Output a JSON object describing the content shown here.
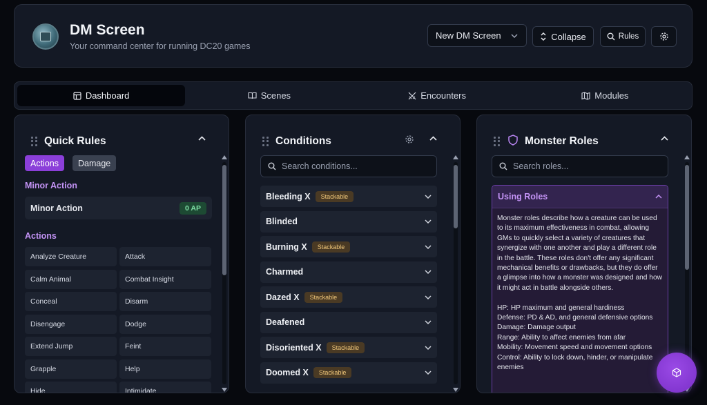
{
  "header": {
    "title": "DM Screen",
    "subtitle": "Your command center for running DC20 games",
    "screen_select": "New DM Screen",
    "collapse_label": "Collapse",
    "rules_label": "Rules"
  },
  "tabs": [
    {
      "label": "Dashboard",
      "icon": "layout-icon",
      "active": true
    },
    {
      "label": "Scenes",
      "icon": "book-open-icon",
      "active": false
    },
    {
      "label": "Encounters",
      "icon": "swords-icon",
      "active": false
    },
    {
      "label": "Modules",
      "icon": "map-icon",
      "active": false
    }
  ],
  "quick_rules": {
    "title": "Quick Rules",
    "chips": [
      "Actions",
      "Damage"
    ],
    "minor_section": "Minor Action",
    "minor_item": {
      "label": "Minor Action",
      "cost": "0 AP"
    },
    "actions_section": "Actions",
    "actions": [
      "Analyze Creature",
      "Attack",
      "Calm Animal",
      "Combat Insight",
      "Conceal",
      "Disarm",
      "Disengage",
      "Dodge",
      "Extend Jump",
      "Feint",
      "Grapple",
      "Help",
      "Hide",
      "Intimidate"
    ]
  },
  "conditions": {
    "title": "Conditions",
    "search_placeholder": "Search conditions...",
    "stack_label": "Stackable",
    "items": [
      {
        "name": "Bleeding X",
        "stackable": true
      },
      {
        "name": "Blinded",
        "stackable": false
      },
      {
        "name": "Burning X",
        "stackable": true
      },
      {
        "name": "Charmed",
        "stackable": false
      },
      {
        "name": "Dazed X",
        "stackable": true
      },
      {
        "name": "Deafened",
        "stackable": false
      },
      {
        "name": "Disoriented X",
        "stackable": true
      },
      {
        "name": "Doomed X",
        "stackable": true
      }
    ]
  },
  "monster_roles": {
    "title": "Monster Roles",
    "search_placeholder": "Search roles...",
    "section_title": "Using Roles",
    "intro": "Monster roles describe how a creature can be used to its maximum effectiveness in combat, allowing GMs to quickly select a variety of creatures that synergize with one another and play a different role in the battle. These roles don't offer any significant mechanical benefits or drawbacks, but they do offer a glimpse into how a monster was designed and how it might act in battle alongside others.",
    "lines": [
      "HP: HP maximum and general hardiness",
      "Defense: PD & AD, and general defensive options",
      "Damage: Damage output",
      "Range: Ability to affect enemies from afar",
      "Mobility: Movement speed and movement options",
      "Control: Ability to lock down, hinder, or manipulate enemies"
    ]
  },
  "colors": {
    "accent": "#8b3fd9",
    "ap_badge": "#1d4a33",
    "stackable": "#4a3a24"
  }
}
